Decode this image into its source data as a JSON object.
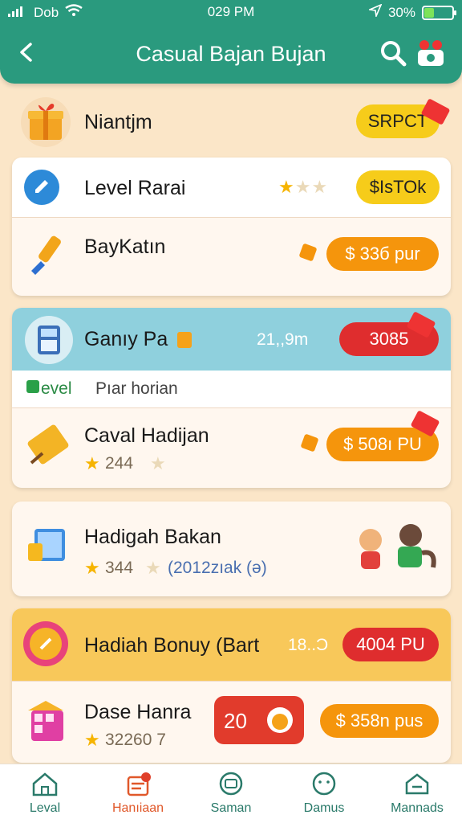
{
  "status_bar": {
    "carrier": "Dob",
    "time": "029 PM",
    "battery": "30%"
  },
  "header": {
    "title": "Casual Bajan Bujan",
    "back_icon": "chevron-left-icon",
    "search_icon": "search-icon",
    "gift_icon": "gift-icon"
  },
  "rows": [
    {
      "label": "Niantjm",
      "pill": "SRPCT",
      "icon": "gift-box-icon"
    },
    {
      "label": "Level Rarai",
      "pill": "$IsTOk",
      "rating": 1,
      "icon": "edit-icon"
    },
    {
      "label": "BayKatın",
      "pill": "$ 33б pur",
      "icon": "brush-icon"
    },
    {
      "label": "Ganıy Pa",
      "value": "21,,9m",
      "pill": "3085",
      "icon": "calculator-icon"
    },
    {
      "label": "Pıar horian",
      "prefix": "evel"
    },
    {
      "label": "Caval Hadijan",
      "rating_text": "244",
      "pill": "$ 508ı PU",
      "icon": "ticket-icon"
    },
    {
      "label": "Hadigah Bakan",
      "rating_text": "344",
      "extra": "(2012zıak (ə)",
      "icon": "chart-icon"
    },
    {
      "label": "Hadiah Bonuy (Bart",
      "value": "18..Ɔ",
      "pill": "4004 PU",
      "icon": "badge-icon"
    },
    {
      "label": "Dase Hanra",
      "rating_text": "32260 7",
      "counter": "20",
      "pill": "$ 358n pus",
      "icon": "gift-box-pink-icon"
    }
  ],
  "nav": [
    {
      "label": "Leval",
      "icon": "house-icon",
      "active": false
    },
    {
      "label": "Hanıiaan",
      "icon": "store-icon",
      "active": true
    },
    {
      "label": "Saman",
      "icon": "wallet-icon",
      "active": false
    },
    {
      "label": "Damus",
      "icon": "face-icon",
      "active": false
    },
    {
      "label": "Mannads",
      "icon": "home-alt-icon",
      "active": false
    }
  ],
  "colors": {
    "header": "#2a9a7e",
    "accent_orange": "#f5950c",
    "accent_red": "#df2d2e",
    "accent_yellow": "#f6cc1a",
    "background": "#fbe6c8"
  }
}
